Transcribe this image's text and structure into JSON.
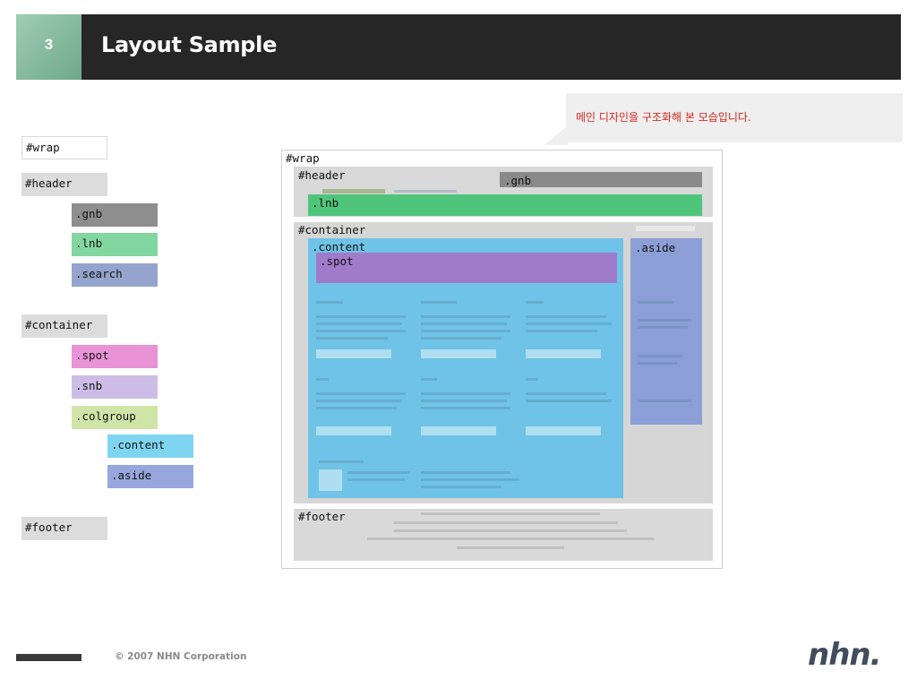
{
  "slide": {
    "number": "3",
    "title": "Layout Sample"
  },
  "callout": {
    "text": "메인 디자인을 구조화해 본 모습입니다."
  },
  "legend": {
    "wrap": "#wrap",
    "header": "#header",
    "gnb": ".gnb",
    "lnb": ".lnb",
    "search": ".search",
    "container": "#container",
    "spot": ".spot",
    "snb": ".snb",
    "colgroup": ".colgroup",
    "content": ".content",
    "aside": ".aside",
    "footer": "#footer"
  },
  "diagram": {
    "wrap": "#wrap",
    "header": "#header",
    "gnb": ".gnb",
    "lnb": ".lnb",
    "container": "#container",
    "content": ".content",
    "spot": ".spot",
    "aside": ".aside",
    "footer": "#footer"
  },
  "colors": {
    "gnb": "#8e8e8e",
    "lnb": "#82d7a0",
    "search": "#94a4cc",
    "spot": "#e893d5",
    "snb": "#cdbde6",
    "colgroup": "#cfe5a8",
    "content": "#7fd5f1",
    "aside": "#97a7de",
    "callout_text": "#d8251d"
  },
  "footer": {
    "copyright": "© 2007 NHN Corporation",
    "logo": "nhn."
  }
}
